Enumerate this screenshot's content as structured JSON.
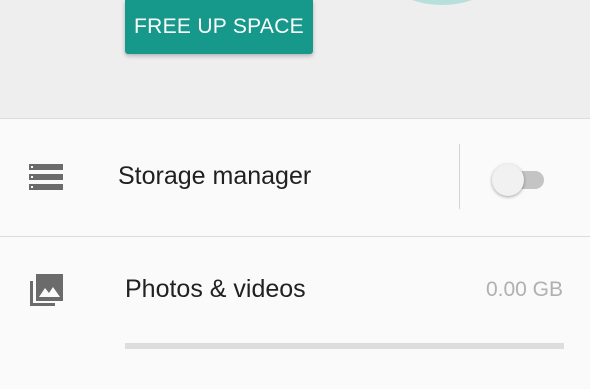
{
  "header": {
    "free_up_space_label": "FREE UP SPACE"
  },
  "storage_manager": {
    "label": "Storage manager",
    "toggle_on": false,
    "icon": "storage-icon"
  },
  "photos_videos": {
    "label": "Photos & videos",
    "size": "0.00 GB",
    "usage_fraction": 0,
    "icon": "photo-library-icon"
  },
  "colors": {
    "accent": "#16998b",
    "ring": "#b7dfdb"
  }
}
